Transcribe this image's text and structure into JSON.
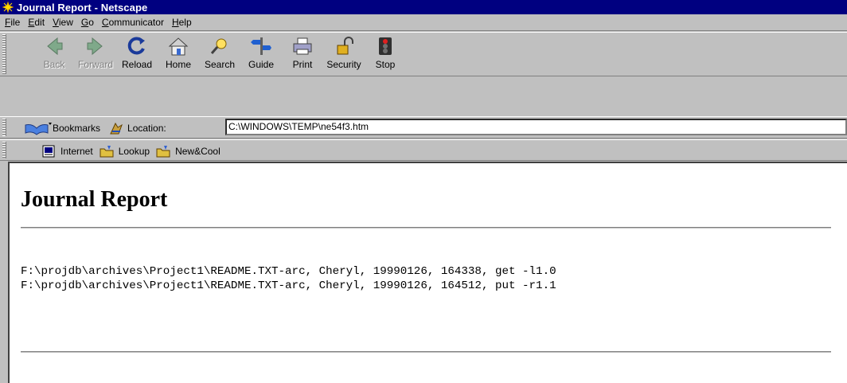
{
  "window": {
    "title": "Journal Report - Netscape"
  },
  "menu": [
    {
      "key": "F",
      "rest": "ile"
    },
    {
      "key": "E",
      "rest": "dit"
    },
    {
      "key": "V",
      "rest": "iew"
    },
    {
      "key": "G",
      "rest": "o"
    },
    {
      "key": "C",
      "rest": "ommunicator"
    },
    {
      "key": "H",
      "rest": "elp"
    }
  ],
  "nav": {
    "back": "Back",
    "forward": "Forward",
    "reload": "Reload",
    "home": "Home",
    "search": "Search",
    "guide": "Guide",
    "print": "Print",
    "security": "Security",
    "stop": "Stop"
  },
  "location": {
    "bookmarks_label": "Bookmarks",
    "label": "Location:",
    "url": "C:\\WINDOWS\\TEMP\\ne54f3.htm"
  },
  "personal": {
    "internet": "Internet",
    "lookup": "Lookup",
    "newcool": "New&Cool"
  },
  "page": {
    "title": "Journal Report",
    "lines": [
      "F:\\projdb\\archives\\Project1\\README.TXT-arc, Cheryl, 19990126, 164338, get -l1.0",
      "F:\\projdb\\archives\\Project1\\README.TXT-arc, Cheryl, 19990126, 164512, put -r1.1"
    ]
  }
}
